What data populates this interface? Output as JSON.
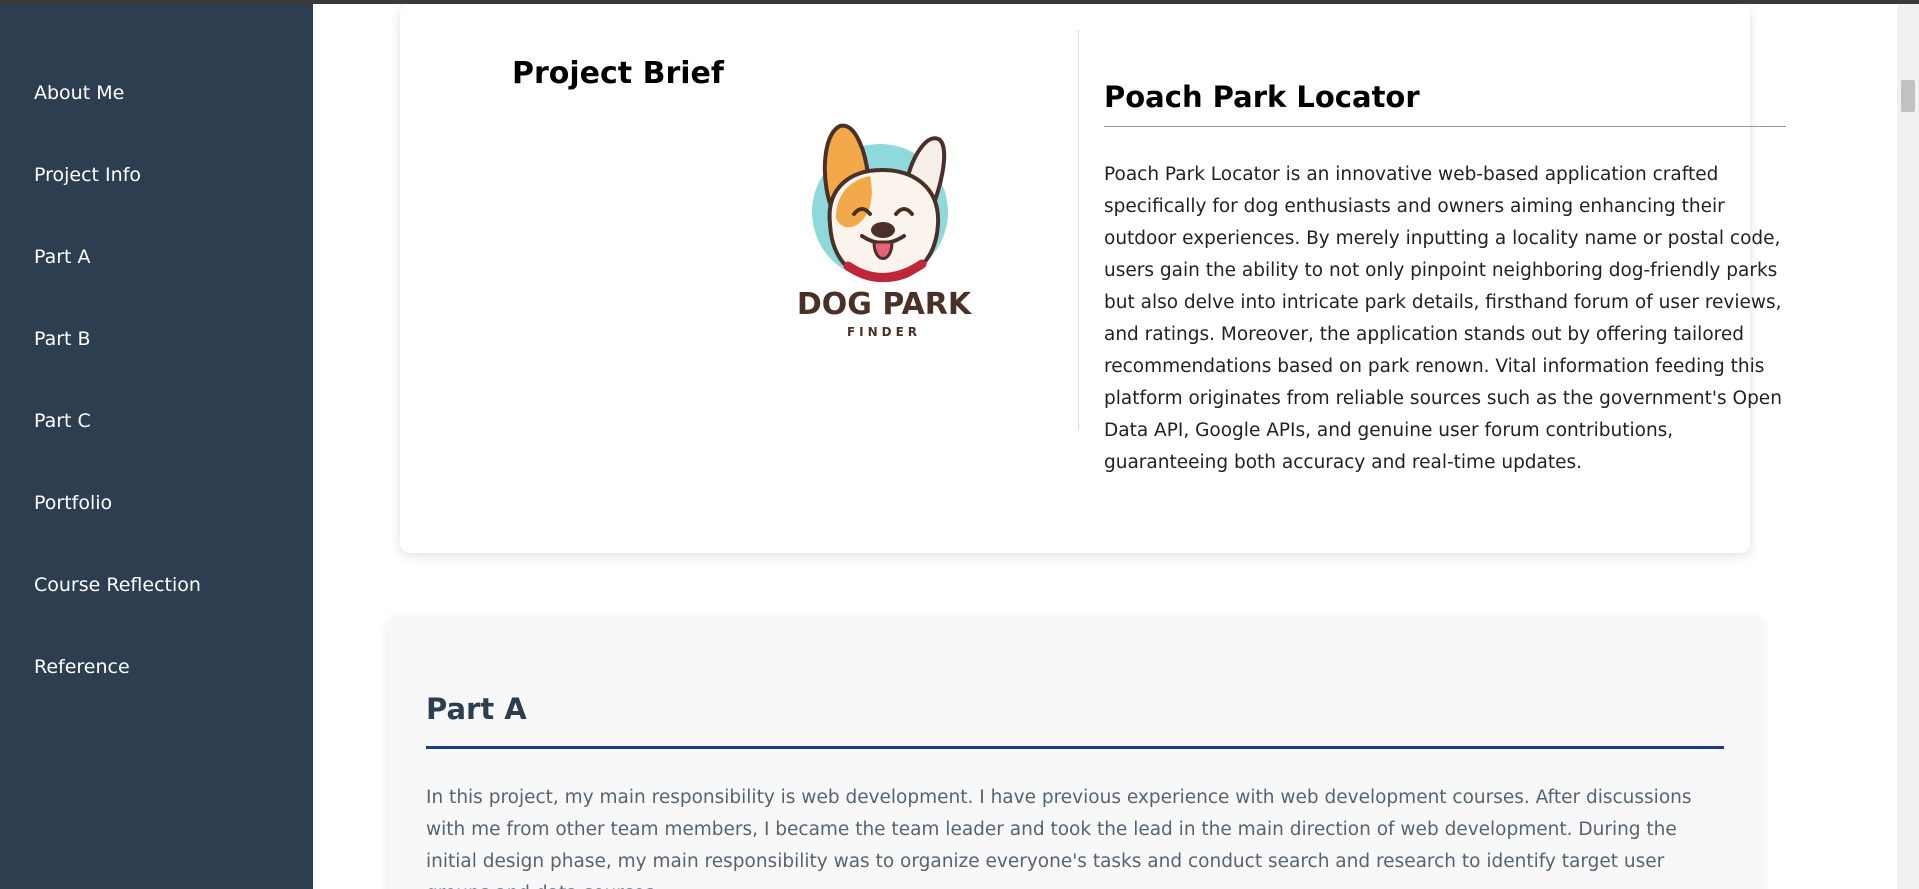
{
  "sidebar": {
    "items": [
      {
        "label": "About Me"
      },
      {
        "label": "Project Info"
      },
      {
        "label": "Part A"
      },
      {
        "label": "Part B"
      },
      {
        "label": "Part C"
      },
      {
        "label": "Portfolio"
      },
      {
        "label": "Course Reflection"
      },
      {
        "label": "Reference"
      }
    ]
  },
  "brief": {
    "heading": "Project Brief",
    "logo": {
      "line1": "DOG PARK",
      "line2": "FINDER",
      "icon": "bulldog-logo"
    },
    "project_title": "Poach Park Locator",
    "description": "Poach Park Locator is an innovative web-based application crafted specifically for dog enthusiasts and owners aiming enhancing their outdoor experiences. By merely inputting a locality name or postal code, users gain the ability to not only pinpoint neighboring dog-friendly parks but also delve into intricate park details, firsthand forum of user reviews, and ratings. Moreover, the application stands out by offering tailored recommendations based on park renown. Vital information feeding this platform originates from reliable sources such as the government's Open Data API, Google APIs, and genuine user forum contributions, guaranteeing both accuracy and real-time updates."
  },
  "part_a": {
    "heading": "Part A",
    "text": "In this project, my main responsibility is web development. I have previous experience with web development courses. After discussions with me from other team members, I became the team leader and took the lead in the main direction of web development. During the initial design phase, my main responsibility was to organize everyone's tasks and conduct search and research to identify target user groups and data sources."
  },
  "colors": {
    "sidebar_bg": "#2c3e50",
    "accent_rule": "#1e3a8a",
    "logo_teal": "#8fd8dc",
    "logo_orange": "#f3a94a",
    "logo_brown": "#4a3128"
  }
}
